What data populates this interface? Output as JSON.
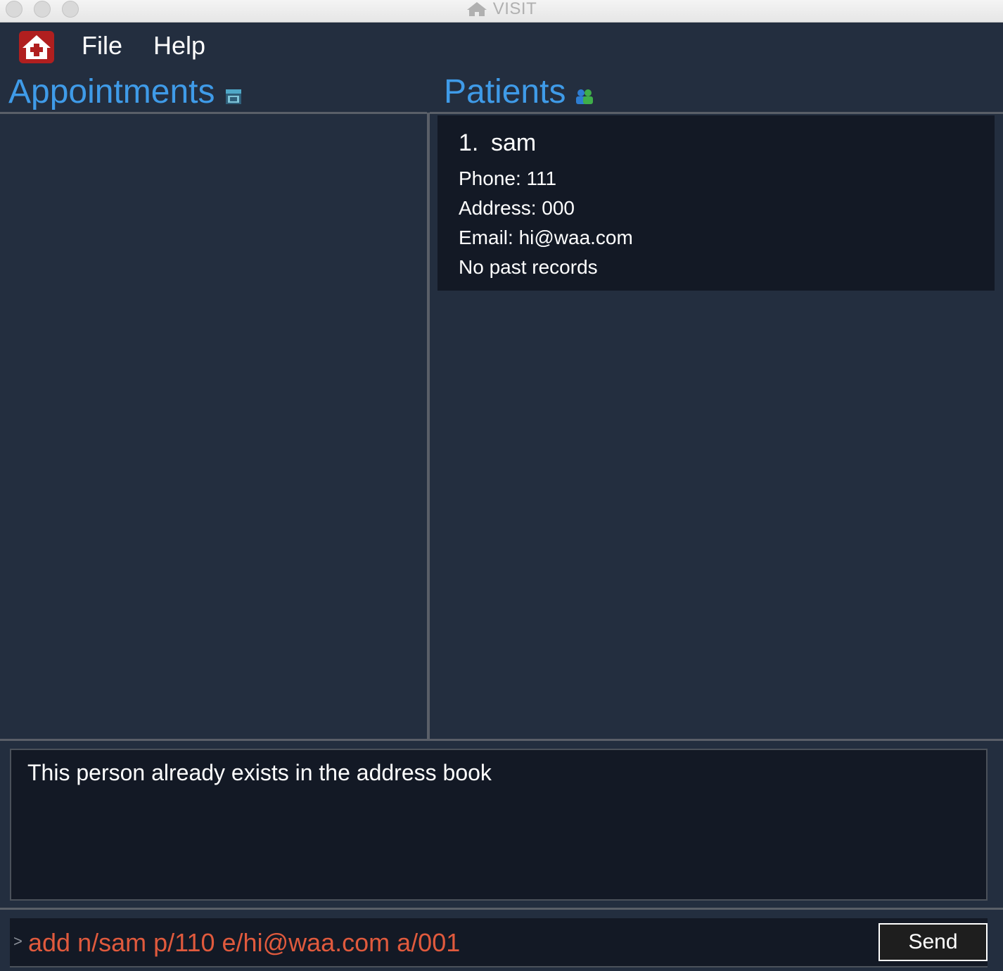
{
  "window": {
    "title": "VISIT",
    "title_icon": "house-icon"
  },
  "menubar": {
    "logo_icon": "house-cross-icon",
    "items": [
      {
        "label": "File"
      },
      {
        "label": "Help"
      }
    ]
  },
  "appointments": {
    "title": "Appointments",
    "icon": "calendar-icon",
    "items": []
  },
  "patients": {
    "title": "Patients",
    "icon": "people-icon",
    "items": [
      {
        "index": "1.",
        "name": "sam",
        "phone": "Phone: 111",
        "address": "Address: 000",
        "email": "Email: hi@waa.com",
        "records": "No past records"
      }
    ]
  },
  "result": {
    "message": "This person already exists in the address book"
  },
  "command": {
    "prompt": ">",
    "value": "add n/sam p/110 e/hi@waa.com a/001",
    "send_label": "Send"
  },
  "colors": {
    "background": "#232e3f",
    "panel": "#131925",
    "accent": "#3f9be8",
    "command_text": "#e05a3d",
    "logo_red": "#b01f1f"
  }
}
